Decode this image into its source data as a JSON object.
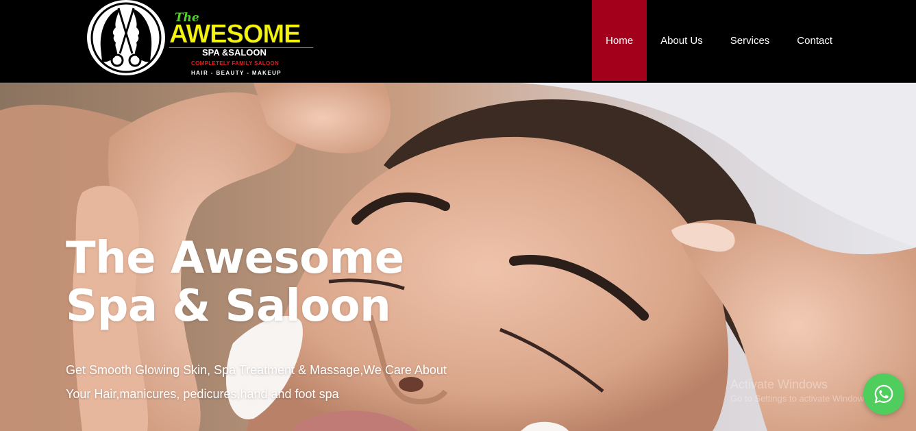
{
  "brand": {
    "logo_the": "The",
    "logo_awesome": "AWESOME",
    "logo_spa": "SPA &SALOON",
    "logo_family": "COMPLETELY FAMILY SALOON",
    "logo_tagline": "HAIR - BEAUTY - MAKEUP",
    "colors": {
      "awesome": "#f5f50a",
      "the": "#54d42b",
      "family": "#e51b1b"
    }
  },
  "nav": {
    "items": [
      {
        "label": "Home",
        "active": true
      },
      {
        "label": "About Us",
        "active": false
      },
      {
        "label": "Services",
        "active": false
      },
      {
        "label": "Contact",
        "active": false
      }
    ],
    "active_color": "#a3001b"
  },
  "hero": {
    "title_line1": "The Awesome",
    "title_line2": "Spa & Saloon",
    "subtitle_line1": "Get Smooth Glowing Skin, Spa Treatment & Massage,We Care About",
    "subtitle_line2": "Your Hair,manicures, pedicures,hand and foot spa"
  },
  "watermark": {
    "line1": "Activate Windows",
    "line2": "Go to Settings to activate Windows."
  },
  "whatsapp": {
    "icon": "whatsapp-icon",
    "color": "#4fce5d"
  }
}
